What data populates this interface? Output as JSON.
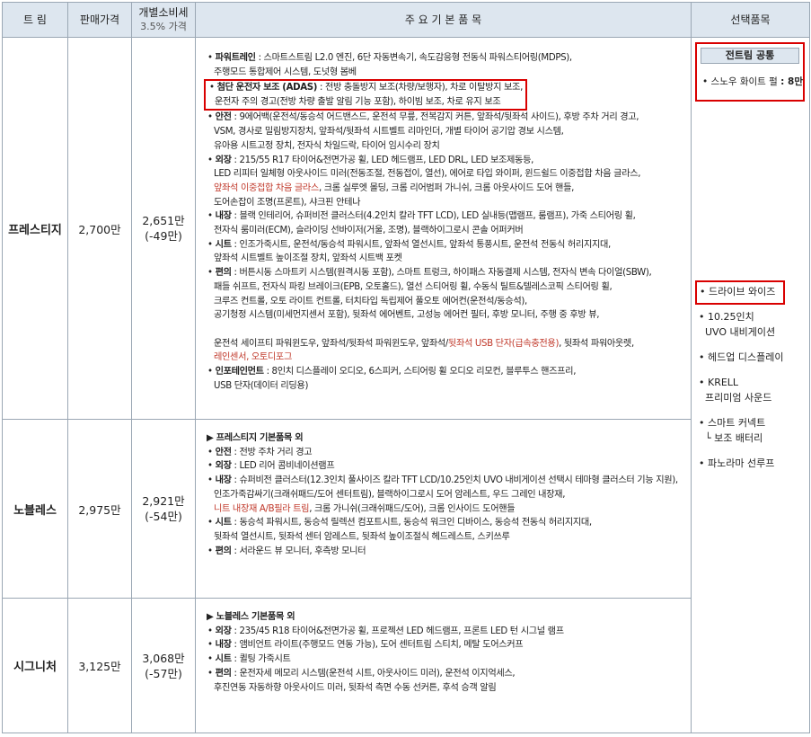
{
  "header": {
    "trim": "트 림",
    "price": "판매가격",
    "individual_line1": "개별소비세",
    "individual_line2": "3.5% 가격",
    "basic_items": "주 요 기 본 품 목",
    "options": "선택품목"
  },
  "rows": [
    {
      "trim": "프레스티지",
      "price": "2,700만",
      "ind_price": "2,651만",
      "ind_diff": "(-49만)",
      "items": [
        {
          "label": "파워트레인",
          "text": " : 스마트스트림 L2.0 엔진, 6단 자동변속기, 속도감응형 전동식 파워스티어링(MDPS),",
          "cont": [
            "주행모드 통합제어 시스템, 도넛형 봄베"
          ]
        },
        {
          "label": "첨단 운전자 보조 (ADAS)",
          "text": " : 전방 충돌방지 보조(차량/보행자), 차로 이탈방지 보조,",
          "cont": [
            "운전자 주의 경고(전방 차량 출발 알림 기능 포함), 하이빔 보조, 차로 유지 보조"
          ]
        },
        {
          "label": "안전",
          "text": " : 9에어백(운전석/동승석 어드밴스드, 운전석 무릎, 전복감지 커튼, 앞좌석/뒷좌석 사이드), 후방 주차 거리 경고,",
          "cont": [
            "VSM, 경사로 밀림방지장치, 앞좌석/뒷좌석 시트벨트 리마인더, 개별 타이어 공기압 경보 시스템,",
            "유아용 시트고정 장치, 전자식 차일드락, 타이어 임시수리 장치"
          ]
        },
        {
          "label": "외장",
          "text": " : 215/55 R17 타이어&전면가공 휠, LED 헤드램프, LED DRL, LED 보조제동등,",
          "cont": [
            "LED 리피터 일체형 아웃사이드 미러(전동조절, 전동접이, 열선), 에어로 타입 와이퍼, 윈드쉴드 이중접합 차음 글라스,"
          ],
          "red_line": "앞좌석 이중접합 차음 글라스",
          "after_red": ", 크롬 실루엣 몰딩, 크롬 리어범퍼 가니쉬, 크롬 아웃사이드 도어 핸들,",
          "cont2": [
            "도어손잡이 조명(프론트), 샤크핀 안테나"
          ]
        },
        {
          "label": "내장",
          "text": " : 블랙 인테리어, 슈퍼비전 클러스터(4.2인치 칼라 TFT LCD), LED 실내등(맵램프, 룸램프), 가죽 스티어링 휠,",
          "cont": [
            "전자식 룸미러(ECM), 슬라이딩 선바이저(거울, 조명), 블랙하이그로시 콘솔 어퍼커버"
          ]
        },
        {
          "label": "시트",
          "text": " : 인조가죽시트, 운전석/동승석 파워시트, 앞좌석 열선시트, 앞좌석 통풍시트, 운전석 전동식 허리지지대,",
          "cont": [
            "앞좌석 시트벨트 높이조절 장치, 앞좌석 시트백 포켓"
          ]
        },
        {
          "label": "편의",
          "text": " : 버튼시동 스마트키 시스템(원격시동 포함), 스마트 트렁크, 하이패스 자동결제 시스템, 전자식 변속 다이얼(SBW),",
          "cont": [
            "패들 쉬프트, 전자식 파킹 브레이크(EPB, 오토홀드), 열선 스티어링 휠, 수동식 틸트&텔레스코픽 스티어링 휠,",
            "크루즈 컨트롤, 오토 라이트 컨트롤, 터치타입 독립제어 풀오토 에어컨(운전석/동승석),",
            "공기청정 시스템(미세먼지센서 포함), 뒷좌석 에어벤트, 고성능 에어컨 필터, 후방 모니터, 주행 중 후방 뷰,"
          ],
          "mix": [
            "운전석 세이프티 파워윈도우, 앞좌석/뒷좌석 파워윈도우, 앞좌석/",
            "뒷좌석 USB 단자(급속충전용)",
            ", 뒷좌석 파워아웃렛,"
          ],
          "red_last": "레인센서, 오토디포그"
        },
        {
          "label": "인포테인먼트",
          "text": " : 8인치 디스플레이 오디오, 6스피커, 스티어링 휠 오디오 리모컨, 블루투스 핸즈프리,",
          "cont": [
            "USB 단자(데이터 리딩용)"
          ]
        }
      ]
    },
    {
      "trim": "노블레스",
      "price": "2,975만",
      "ind_price": "2,921만",
      "ind_diff": "(-54만)",
      "heading": "▶ 프레스티지 기본품목 외",
      "items": [
        {
          "label": "안전",
          "text": " : 전방 주차 거리 경고",
          "cont": []
        },
        {
          "label": "외장",
          "text": " : LED 리어 콤비네이션램프",
          "cont": []
        },
        {
          "label": "내장",
          "text": " : 슈퍼비전 클러스터(12.3인치 풀사이즈 칼라 TFT LCD/10.25인치 UVO 내비게이션 선택시 테마형 클러스터 기능 지원),",
          "cont": [
            "인조가죽감싸기(크래쉬패드/도어 센터트림), 블랙하이그로시 도어 암레스트, 우드 그레인 내장재,"
          ],
          "red_line": "니트 내장재 A/B필라 트림",
          "after_red": ", 크롬 가니쉬(크래쉬패드/도어), 크롬 인사이드 도어핸들"
        },
        {
          "label": "시트",
          "text": " : 동승석 파워시트, 동승석 릴렉션 컴포트시트, 동승석 워크인 디바이스, 동승석 전동식 허리지지대,",
          "cont": [
            "뒷좌석 열선시트, 뒷좌석 센터 암레스트, 뒷좌석 높이조절식 헤드레스트, 스키쓰루"
          ]
        },
        {
          "label": "편의",
          "text": " : 서라운드 뷰 모니터, 후측방 모니터",
          "cont": []
        }
      ]
    },
    {
      "trim": "시그니처",
      "price": "3,125만",
      "ind_price": "3,068만",
      "ind_diff": "(-57만)",
      "heading": "▶ 노블레스 기본품목 외",
      "items": [
        {
          "label": "외장",
          "text": " : 235/45 R18 타이어&전면가공 휠, 프로젝션 LED 헤드램프, 프론트 LED 턴 시그널 램프",
          "cont": []
        },
        {
          "label": "내장",
          "text": " : 앰비언트 라이트(주행모드 연동 가능), 도어 센터트림 스티치, 메탈 도어스커프",
          "cont": []
        },
        {
          "label": "시트",
          "text": " : 퀼팅 가죽시트",
          "cont": []
        },
        {
          "label": "편의",
          "text": " : 운전자세 메모리 시스템(운전석 시트, 아웃사이드 미러), 운전석 이지억세스,",
          "cont": [
            "후진연동 자동하향 아웃사이드 미러, 뒷좌석 측면 수동 선커튼, 후석 승객 알림"
          ]
        }
      ]
    }
  ],
  "options": {
    "common_title": "전트림 공통",
    "snow_white": "• 스노우 화이트 펄",
    "snow_white_price": ": 8만",
    "drive_wise": "• 드라이브 와이즈",
    "nav_line1": "• 10.25인치",
    "nav_line2": "UVO 내비게이션",
    "hud": "• 헤드업 디스플레이",
    "krell_line1": "• KRELL",
    "krell_line2": "프리미엄 사운드",
    "smart_connect_line1": "• 스마트 커넥트",
    "smart_connect_line2": "└ 보조 배터리",
    "sunroof": "• 파노라마 선루프"
  },
  "colors": {
    "header_bg": "#dde6ef",
    "border": "#9aa7b4",
    "highlight_box": "#d90000",
    "red_text": "#c0392b"
  }
}
